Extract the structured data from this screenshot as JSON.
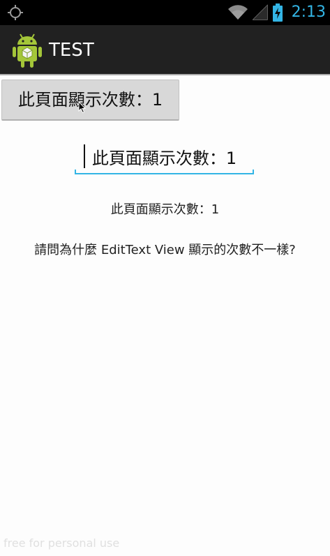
{
  "status_bar": {
    "time": "2:13",
    "accent_color": "#33b5e5",
    "left_icon": "gps-icon",
    "right_icons": [
      "wifi-icon",
      "signal-icon",
      "battery-charging-icon"
    ]
  },
  "action_bar": {
    "app_icon": "android-robot-icon",
    "title": "TEST"
  },
  "content": {
    "button_label": "此頁面顯示次數：1",
    "edit_text_value": "此頁面顯示次數：1",
    "text_view": "此頁面顯示次數：1",
    "question": "請問為什麼 EditText View 顯示的次數不一樣?"
  },
  "watermark": "free for personal use"
}
